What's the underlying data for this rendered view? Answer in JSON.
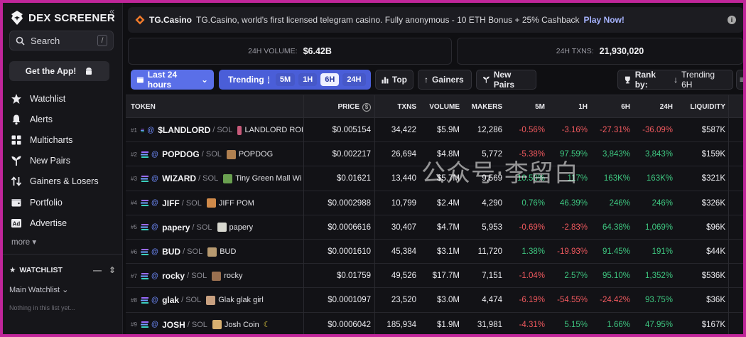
{
  "app": {
    "logo_text": "DEX SCREENER"
  },
  "sidebar": {
    "search": "Search",
    "search_kbd": "/",
    "get_app": "Get the App!",
    "items": [
      {
        "label": "Watchlist",
        "icon": "star-icon"
      },
      {
        "label": "Alerts",
        "icon": "bell-icon"
      },
      {
        "label": "Multicharts",
        "icon": "grid-icon"
      },
      {
        "label": "New Pairs",
        "icon": "seedling-icon"
      },
      {
        "label": "Gainers & Losers",
        "icon": "arrows-icon"
      },
      {
        "label": "Portfolio",
        "icon": "wallet-icon"
      },
      {
        "label": "Advertise",
        "icon": "ad-icon"
      }
    ],
    "more": "more",
    "watchlist_title": "WATCHLIST",
    "watchlist_select": "Main Watchlist",
    "watchlist_empty": "Nothing in this list yet..."
  },
  "banner": {
    "brand": "TG.Casino",
    "text": "TG.Casino, world's first licensed telegram casino. Fully anonymous - 10 ETH Bonus + 25% Cashback",
    "cta": "Play Now!"
  },
  "stats": {
    "volume_label": "24H VOLUME:",
    "volume_value": "$6.42B",
    "txns_label": "24H TXNS:",
    "txns_value": "21,930,020"
  },
  "toolbar": {
    "timeframe": "Last 24 hours",
    "trending": "Trending",
    "pills": [
      "5M",
      "1H",
      "6H",
      "24H"
    ],
    "selected_pill": "6H",
    "top": "Top",
    "gainers": "Gainers",
    "new_pairs": "New Pairs",
    "rank_by_label": "Rank by:",
    "rank_by_value": "Trending 6H"
  },
  "table": {
    "headers": {
      "token": "TOKEN",
      "price": "PRICE",
      "txns": "TXNS",
      "volume": "VOLUME",
      "makers": "MAKERS",
      "m5": "5M",
      "h1": "1H",
      "h6": "6H",
      "h24": "24H",
      "liquidity": "LIQUIDITY"
    },
    "rows": [
      {
        "rank": "#1",
        "symbol": "$LANDLORD",
        "pair": "/ SOL",
        "name": "LANDLORD ROI",
        "price": "$0.005154",
        "txns": "34,422",
        "volume": "$5.9M",
        "makers": "12,286",
        "m5": "-0.56%",
        "h1": "-3.16%",
        "h6": "-27.31%",
        "h24": "-36.09%",
        "liquidity": "$587K",
        "avatar_color": "#c85a7a"
      },
      {
        "rank": "#2",
        "symbol": "POPDOG",
        "pair": "/ SOL",
        "name": "POPDOG",
        "price": "$0.002217",
        "txns": "26,694",
        "volume": "$4.8M",
        "makers": "5,772",
        "m5": "-5.38%",
        "h1": "97.59%",
        "h6": "3,843%",
        "h24": "3,843%",
        "liquidity": "$159K",
        "avatar_color": "#b08050"
      },
      {
        "rank": "#3",
        "symbol": "WIZARD",
        "pair": "/ SOL",
        "name": "Tiny Green Mall Wi",
        "price": "$0.01621",
        "txns": "13,440",
        "volume": "$5.7M",
        "makers": "9,569",
        "m5": "10.50%",
        "h1": "117%",
        "h6": "163K%",
        "h24": "163K%",
        "liquidity": "$321K",
        "avatar_color": "#6aa050"
      },
      {
        "rank": "#4",
        "symbol": "JIFF",
        "pair": "/ SOL",
        "name": "JIFF POM",
        "price": "$0.0002988",
        "txns": "10,799",
        "volume": "$2.4M",
        "makers": "4,290",
        "m5": "0.76%",
        "h1": "46.39%",
        "h6": "246%",
        "h24": "246%",
        "liquidity": "$326K",
        "avatar_color": "#d08a4a"
      },
      {
        "rank": "#5",
        "symbol": "papery",
        "pair": "/ SOL",
        "name": "papery",
        "price": "$0.0006616",
        "txns": "30,407",
        "volume": "$4.7M",
        "makers": "5,953",
        "m5": "-0.69%",
        "h1": "-2.83%",
        "h6": "64.38%",
        "h24": "1,069%",
        "liquidity": "$96K",
        "avatar_color": "#d8d8d0"
      },
      {
        "rank": "#6",
        "symbol": "BUD",
        "pair": "/ SOL",
        "name": "BUD",
        "price": "$0.0001610",
        "txns": "45,384",
        "volume": "$3.1M",
        "makers": "11,720",
        "m5": "1.38%",
        "h1": "-19.93%",
        "h6": "91.45%",
        "h24": "191%",
        "liquidity": "$44K",
        "avatar_color": "#b89a70"
      },
      {
        "rank": "#7",
        "symbol": "rocky",
        "pair": "/ SOL",
        "name": "rocky",
        "price": "$0.01759",
        "txns": "49,526",
        "volume": "$17.7M",
        "makers": "7,151",
        "m5": "-1.04%",
        "h1": "2.57%",
        "h6": "95.10%",
        "h24": "1,352%",
        "liquidity": "$536K",
        "avatar_color": "#9a7050"
      },
      {
        "rank": "#8",
        "symbol": "glak",
        "pair": "/ SOL",
        "name": "Glak glak girl",
        "price": "$0.0001097",
        "txns": "23,520",
        "volume": "$3.0M",
        "makers": "4,474",
        "m5": "-6.19%",
        "h1": "-54.55%",
        "h6": "-24.42%",
        "h24": "93.75%",
        "liquidity": "$36K",
        "avatar_color": "#c8a080"
      },
      {
        "rank": "#9",
        "symbol": "JOSH",
        "pair": "/ SOL",
        "name": "Josh Coin",
        "price": "$0.0006042",
        "txns": "185,934",
        "volume": "$1.9M",
        "makers": "31,981",
        "m5": "-4.31%",
        "h1": "5.15%",
        "h6": "1.66%",
        "h24": "47.95%",
        "liquidity": "$167K",
        "avatar_color": "#d8b070"
      }
    ]
  },
  "watermark": "公众号·李留白",
  "colors": {
    "accent": "#5a6fe8",
    "positive": "#3ec780",
    "negative": "#f0595e",
    "border": "#c0269a"
  }
}
